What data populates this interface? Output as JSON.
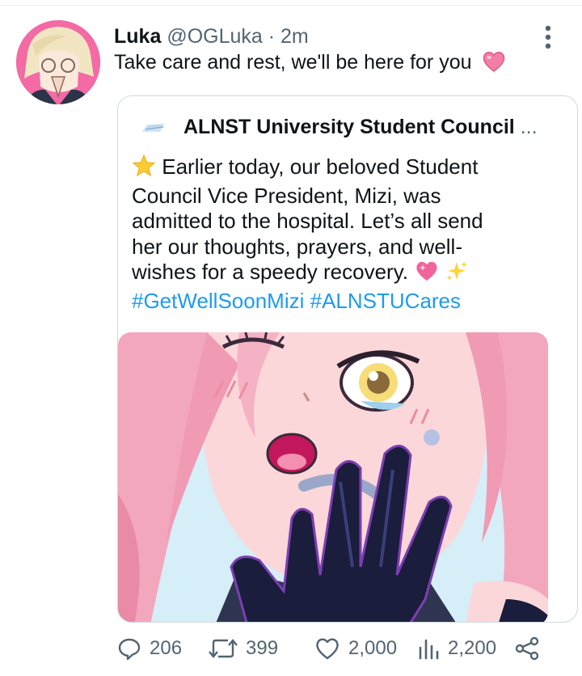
{
  "tweet": {
    "author_name": "Luka",
    "author_handle": "@OGLuka",
    "separator": "·",
    "time": "2m",
    "text": "Take care and rest, we'll be here for you",
    "text_emoji": "heart-icon"
  },
  "quote": {
    "author_name": "ALNST University Student Council",
    "name_truncation": "...",
    "lines": [
      "Earlier today, our beloved Student",
      "Council Vice President, Mizi, was",
      "admitted to the hospital. Let’s all send",
      "her our thoughts, prayers, and well-",
      "wishes for a speedy recovery."
    ],
    "hashtags": [
      "#GetWellSoonMizi",
      "#ALNSTUCares"
    ],
    "image_alt": "anime illustration of a pink-haired girl winking with a gloved hand near her face"
  },
  "actions": {
    "replies": "206",
    "retweets": "399",
    "likes": "2,000",
    "views": "2,200"
  },
  "colors": {
    "link": "#1d9bf0",
    "secondary_text": "#536471",
    "border": "#cfd9de"
  }
}
